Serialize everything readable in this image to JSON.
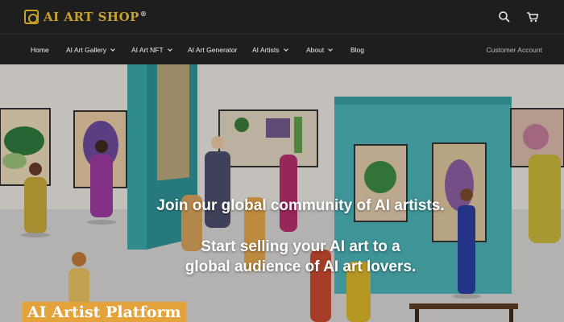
{
  "header": {
    "logo_text": "AI ART SHOP",
    "logo_mark": "®",
    "icons": [
      "search-icon",
      "cart-icon"
    ]
  },
  "nav": {
    "items": [
      {
        "label": "Home",
        "dropdown": false
      },
      {
        "label": "AI Art Gallery",
        "dropdown": true
      },
      {
        "label": "AI Art NFT",
        "dropdown": true
      },
      {
        "label": "AI Art Generator",
        "dropdown": false
      },
      {
        "label": "AI Artists",
        "dropdown": true
      },
      {
        "label": "About",
        "dropdown": true
      },
      {
        "label": "Blog",
        "dropdown": false
      }
    ],
    "account_label": "Customer Account"
  },
  "hero": {
    "headline": "Join our global community of AI artists.",
    "sub_line_1": "Start selling your AI art to a",
    "sub_line_2": "global audience of AI art lovers.",
    "badge": "AI Artist Platform"
  },
  "colors": {
    "header_bg": "#1e1e1e",
    "logo_gold": "#c9a227",
    "badge_bg": "#e3a23a",
    "wall_teal": "#3aa6a8"
  }
}
